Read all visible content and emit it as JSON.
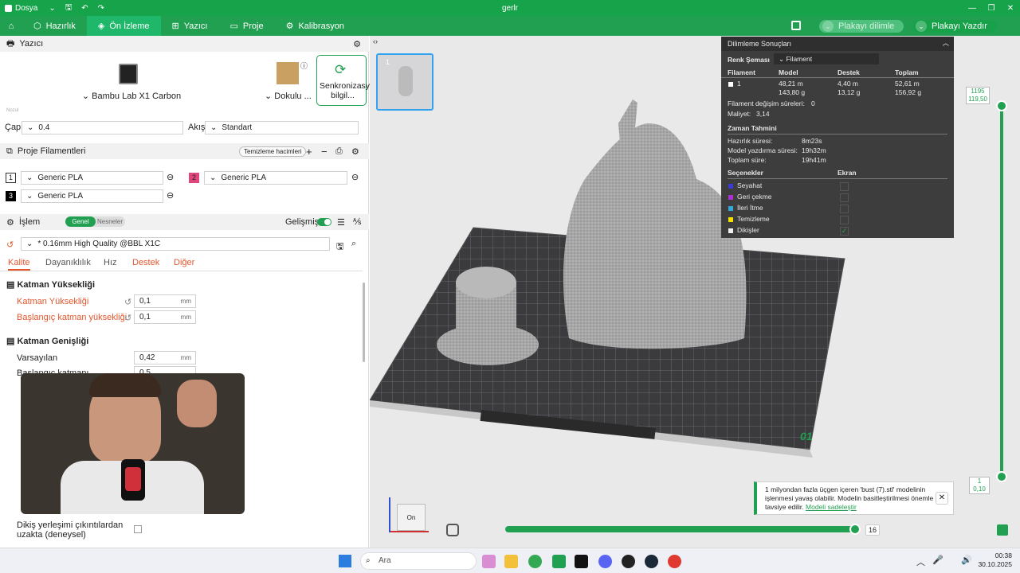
{
  "titlebar": {
    "menu": "Dosya",
    "title": "gerlr"
  },
  "nav": {
    "tabs": [
      {
        "label": "Hazırlık"
      },
      {
        "label": "Ön İzleme"
      },
      {
        "label": "Yazıcı"
      },
      {
        "label": "Proje"
      },
      {
        "label": "Kalibrasyon"
      }
    ],
    "slice_label": "Plakayı dilimle",
    "print_label": "Plakayı Yazdır"
  },
  "printer": {
    "section": "Yazıcı",
    "name": "Bambu Lab X1 Carbon",
    "plate": "Dokulu ...",
    "sync_label": "Senkronizasyon bilgil...",
    "nozzle_tag": "Nozul",
    "diameter_label": "Çap",
    "diameter_value": "0.4",
    "flow_label": "Akış",
    "flow_value": "Standart"
  },
  "filaments": {
    "section": "Proje Filamentleri",
    "flush_label": "Temizleme hacimleri",
    "items": [
      {
        "index": "1",
        "name": "Generic PLA",
        "color": "#ffffff"
      },
      {
        "index": "2",
        "name": "Generic PLA",
        "color": "#e0457b"
      },
      {
        "index": "3",
        "name": "Generic PLA",
        "color": "#000000"
      }
    ]
  },
  "process": {
    "section": "İşlem",
    "toggle_general": "Genel",
    "toggle_objects": "Nesneler",
    "advanced_label": "Gelişmiş",
    "preset": "* 0.16mm High Quality @BBL X1C",
    "tabs": [
      "Kalite",
      "Dayanıklılık",
      "Hız",
      "Destek",
      "Diğer"
    ],
    "group1": "Katman Yüksekliği",
    "layer_height_label": "Katman Yüksekliği",
    "layer_height_value": "0,1",
    "first_layer_label": "Başlangıç katman yüksekliği",
    "first_layer_value": "0,1",
    "group2": "Katman Genişliği",
    "default_label": "Varsayılan",
    "default_value": "0,42",
    "initial_layer_label": "Başlangıç katmanı",
    "initial_layer_value": "0,5",
    "unit": "mm",
    "seam_label": "Dikiş yerleşimi çıkıntılardan uzakta (deneysel)"
  },
  "results": {
    "title": "Dilimleme Sonuçları",
    "scheme_label": "Renk Şeması",
    "scheme_value": "Filament",
    "headers": [
      "Filament",
      "Model",
      "Destek",
      "Toplam"
    ],
    "row": {
      "index": "1",
      "model_m": "48,21 m",
      "model_g": "143,80 g",
      "support_m": "4,40 m",
      "support_g": "13,12 g",
      "total_m": "52,61 m",
      "total_g": "156,92 g"
    },
    "changes_label": "Filament değişim süreleri:",
    "changes_value": "0",
    "cost_label": "Maliyet:",
    "cost_value": "3,14",
    "time_title": "Zaman Tahmini",
    "prep_label": "Hazırlık süresi:",
    "prep_value": "8m23s",
    "model_time_label": "Model yazdırma süresi:",
    "model_time_value": "19h32m",
    "total_time_label": "Toplam süre:",
    "total_time_value": "19h41m",
    "options_title": "Seçenekler",
    "display_title": "Ekran",
    "options": [
      {
        "label": "Seyahat",
        "color": "#3b3bd0"
      },
      {
        "label": "Geri çekme",
        "color": "#b02fd0"
      },
      {
        "label": "İleri İtme",
        "color": "#35a7d6"
      },
      {
        "label": "Temizleme",
        "color": "#f5e000"
      },
      {
        "label": "Dikişler",
        "color": "#f0f0f0"
      }
    ]
  },
  "layers": {
    "top_value": "1195",
    "top_height": "119,50",
    "bottom_value": "1",
    "bottom_height": "0,10",
    "moves_value": "16",
    "plate_number": "01",
    "plate_thumb": "1"
  },
  "notification": {
    "text": "1 milyondan fazla üçgen içeren 'bust (7).stl' modelinin işlenmesi yavaş olabilir. Modelin basitleştirilmesi önemle tavsiye edilir.",
    "link": "Modeli sadeleştir"
  },
  "cube": {
    "label": "On"
  },
  "taskbar": {
    "search": "Ara",
    "time": "00:38",
    "date": "30.10.2025"
  }
}
